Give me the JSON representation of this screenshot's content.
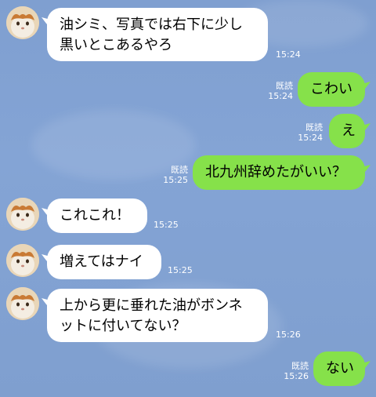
{
  "messages": [
    {
      "side": "in",
      "text_lines": [
        "油シミ、写真では右下に少し",
        "黒いとこあるやろ"
      ],
      "time": "15:24"
    },
    {
      "side": "out",
      "text": "こわい",
      "read": "既読",
      "time": "15:24"
    },
    {
      "side": "out",
      "text": "え",
      "read": "既読",
      "time": "15:24"
    },
    {
      "side": "out",
      "text": "北九州辞めたがいい？",
      "read": "既読",
      "time": "15:25"
    },
    {
      "side": "in",
      "text": "これこれ！",
      "time": "15:25"
    },
    {
      "side": "in",
      "text": "増えてはナイ",
      "time": "15:25"
    },
    {
      "side": "in",
      "text_lines": [
        "上から更に垂れた油がボンネ",
        "ットに付いてない？"
      ],
      "time": "15:26"
    },
    {
      "side": "out",
      "text": "ない",
      "read": "既読",
      "time": "15:26"
    }
  ],
  "colors": {
    "outgoing": "#86e14a",
    "incoming": "#ffffff",
    "background": "#84a4d5"
  },
  "icons": {
    "avatar": "cat-avatar-icon"
  }
}
